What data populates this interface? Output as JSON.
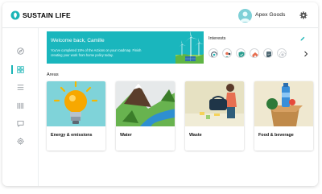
{
  "brand": {
    "name": "SUSTAIN LIFE",
    "accent": "#1bb5b6"
  },
  "user": {
    "name": "Apex Goods"
  },
  "sidebar": {
    "items": [
      {
        "icon": "compass-icon"
      },
      {
        "icon": "dashboard-icon",
        "active": true
      },
      {
        "icon": "list-icon"
      },
      {
        "icon": "barcode-icon"
      },
      {
        "icon": "chat-icon"
      },
      {
        "icon": "settings-icon"
      }
    ]
  },
  "welcome": {
    "title": "Welcome back, Camille",
    "message": "You've completed 15% of the Actions on your roadmap. Finish creating your work from home policy today.",
    "color": "#1ab6bd"
  },
  "interests": {
    "title": "Interests",
    "items": [
      "recycling-icon",
      "people-icon",
      "shield-icon",
      "home-icon",
      "document-icon",
      "badge-icon"
    ]
  },
  "areas": {
    "title": "Areas",
    "cards": [
      {
        "label": "Energy & emissions",
        "icon": "lightbulb-illustration"
      },
      {
        "label": "Water",
        "icon": "river-illustration"
      },
      {
        "label": "Waste",
        "icon": "waste-illustration"
      },
      {
        "label": "Food & beverage",
        "icon": "food-illustration"
      }
    ]
  }
}
